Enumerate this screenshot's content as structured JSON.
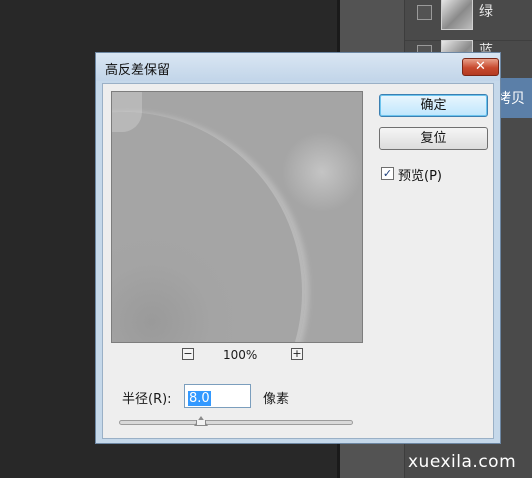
{
  "layers": {
    "rows": [
      {
        "name": "绿"
      },
      {
        "name": "蓝"
      }
    ],
    "selected_label": "拷贝"
  },
  "watermark": "xuexila.com",
  "dialog": {
    "title": "高反差保留",
    "close_glyph": "✕",
    "ok_label": "确定",
    "reset_label": "复位",
    "preview_checked": true,
    "preview_check_glyph": "✓",
    "preview_label": "预览(P)",
    "zoom_out_glyph": "−",
    "zoom_in_glyph": "+",
    "zoom_level": "100%",
    "radius_label": "半径(R):",
    "radius_value": "8.0",
    "radius_unit": "像素",
    "radius_slider_fraction": 0.35
  }
}
